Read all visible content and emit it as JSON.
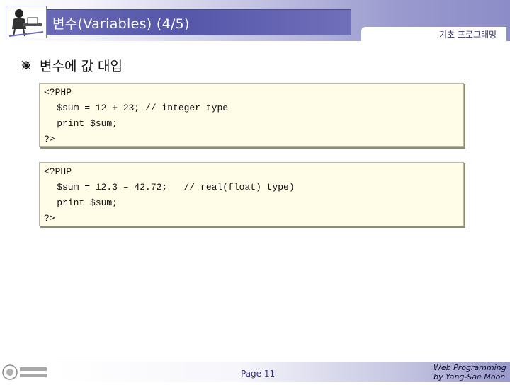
{
  "header": {
    "title": "변수(Variables) (4/5)",
    "subject": "기초 프로그래밍"
  },
  "heading": "변수에 값 대입",
  "code_blocks": [
    {
      "lines": [
        "<?PHP",
        "    $sum = 12 + 23; // integer type",
        "    print $sum;",
        "?>"
      ]
    },
    {
      "lines": [
        "<?PHP",
        "    $sum = 12.3 – 42.72;   // real(float) type)",
        "    print $sum;",
        "?>"
      ]
    }
  ],
  "footer": {
    "page": "Page 11",
    "credit_line1": "Web Programming",
    "credit_line2": "by Yang-Sae Moon"
  },
  "colors": {
    "title_bg": "#5a5aaa",
    "code_bg": "#fffde8",
    "accent": "#8c8cc8"
  },
  "icons": {
    "header_logo": "person-at-desk-icon",
    "bullet": "bullet-icon",
    "footer_logo": "university-logo-icon"
  }
}
